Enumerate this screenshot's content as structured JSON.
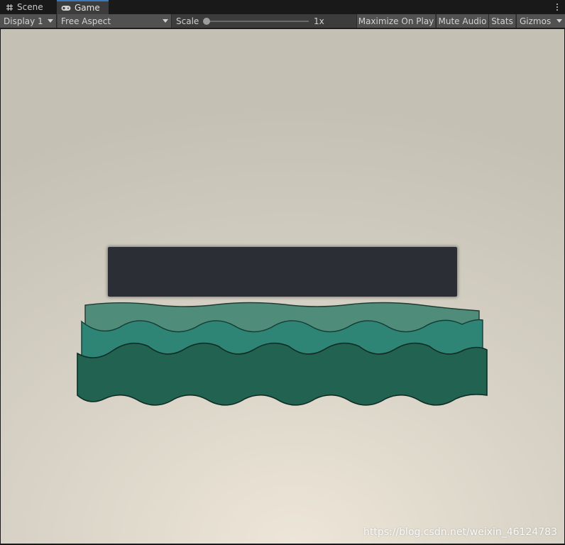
{
  "tabs": [
    {
      "label": "Scene",
      "icon": "grid-icon",
      "active": false
    },
    {
      "label": "Game",
      "icon": "gamepad-icon",
      "active": true
    }
  ],
  "toolbar": {
    "display": "Display 1",
    "aspect": "Free Aspect",
    "scale_label": "Scale",
    "scale_value": "1x",
    "maximize": "Maximize On Play",
    "mute": "Mute Audio",
    "stats": "Stats",
    "gizmos": "Gizmos"
  },
  "game": {
    "watermark": "https://blog.csdn.net/weixin_46124783"
  },
  "colors": {
    "panel": "#2c2e36",
    "wave_back": "#4f8c79",
    "wave_mid": "#2f8575",
    "wave_front": "#216251",
    "accent": "#3a79bb"
  }
}
